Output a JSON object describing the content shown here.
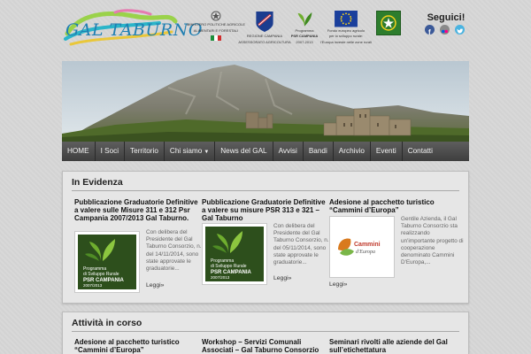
{
  "header": {
    "logo": {
      "text": "GAL TABURNO"
    },
    "partners": [
      {
        "name": "ministero-logo",
        "caption_lines": [
          "MINISTERO POLITICHE AGRICOLE",
          "ALIMENTARI E FORESTALI"
        ]
      },
      {
        "name": "regione-campania-logo",
        "caption_lines": [
          "REGIONE CAMPANIA",
          "ASSESSORATO AGRICOLTURA"
        ]
      },
      {
        "name": "psr-campania-logo",
        "caption_lines": [
          "Programma",
          "PSR CAMPANIA",
          "2007-2013"
        ]
      },
      {
        "name": "eu-flag-logo",
        "caption_lines": [
          "Fondo europeo agricolo",
          "per lo sviluppo rurale:",
          "l'Europa investe nelle zone rurali"
        ]
      },
      {
        "name": "leader-logo",
        "caption_lines": []
      }
    ],
    "social": {
      "title": "Seguici!",
      "icons": [
        "facebook-icon",
        "flickr-icon",
        "twitter-icon"
      ]
    }
  },
  "nav": {
    "items": [
      {
        "label": "HOME"
      },
      {
        "label": "I Soci"
      },
      {
        "label": "Territorio"
      },
      {
        "label": "Chi siamo",
        "dropdown": true
      },
      {
        "label": "News del GAL"
      },
      {
        "label": "Avvisi"
      },
      {
        "label": "Bandi"
      },
      {
        "label": "Archivio"
      },
      {
        "label": "Eventi"
      },
      {
        "label": "Contatti"
      }
    ]
  },
  "evidenza": {
    "title": "In Evidenza",
    "cards": [
      {
        "title": "Pubblicazione Graduatorie Definitive a valere sulle Misure 311 e 312 Psr Campania 2007/2013 Gal Taburno.",
        "excerpt": "Con delibera del Presidente del Gal Taburno Consorzio, n.1 del 14/11/2014, sono state approvate le graduatorie...",
        "read_more": "Leggi»",
        "thumb": {
          "line1": "Programma",
          "line2": "di Sviluppo Rurale",
          "line3": "PSR CAMPANIA",
          "line4": "2007/2013"
        }
      },
      {
        "title": "Pubblicazione Graduatorie Definitive a valere su misure PSR 313 e 321 – Gal Taburno",
        "excerpt": "Con delibera del Presidente del Gal Taburno Consorzio, n.1 del 05/11/2014, sono state approvate le graduatorie...",
        "read_more": "Leggi»",
        "thumb": {
          "line1": "Programma",
          "line2": "di Sviluppo Rurale",
          "line3": "PSR CAMPANIA",
          "line4": "2007/2013"
        }
      },
      {
        "title": "Adesione al pacchetto turistico “Cammini d’Europa”",
        "excerpt": "Gentile Azienda, il Gal Taburno Consorzio sta realizzando un'importante progetto di cooperazione denominato Cammini D'Europa,...",
        "read_more": "Leggi»",
        "thumb": {
          "line1": "Cammini",
          "line2": "d'Europa"
        }
      }
    ]
  },
  "attivita": {
    "title": "Attività in corso",
    "cards": [
      {
        "title": "Adesione al pacchetto turistico “Cammini d’Europa”"
      },
      {
        "title": "Workshop – Servizi Comunali Associati – Gal Taburno Consorzio"
      },
      {
        "title": "Seminari rivolti alle aziende del Gal sull’etichettatura"
      }
    ]
  },
  "colors": {
    "nav_bg": "#4a4a4a",
    "logo_blue": "#1f7fb2",
    "psr_green": "#2d4f1c"
  }
}
